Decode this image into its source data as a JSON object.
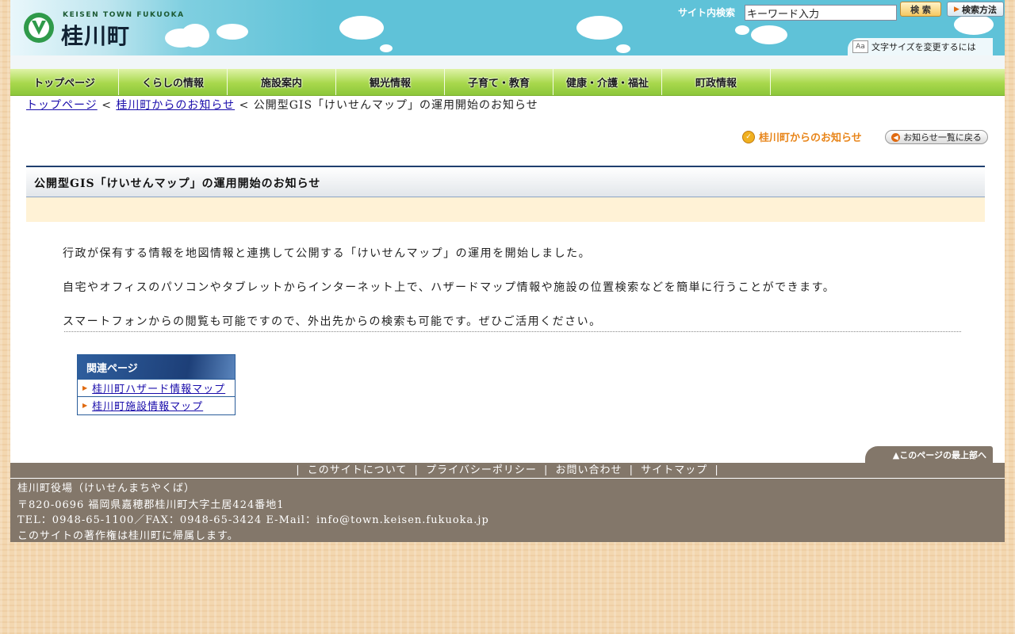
{
  "header": {
    "logo_en": "KEISEN TOWN FUKUOKA",
    "logo_jp": "桂川町",
    "search_label": "サイト内検索",
    "search_value": "キーワード入力",
    "search_button": "検 索",
    "search_method_button": "検索方法",
    "fontsize_link": "文字サイズを変更するには"
  },
  "nav": {
    "items": [
      {
        "label": "トップページ"
      },
      {
        "label": "くらしの情報"
      },
      {
        "label": "施設案内"
      },
      {
        "label": "観光情報"
      },
      {
        "label": "子育て・教育"
      },
      {
        "label": "健康・介護・福祉"
      },
      {
        "label": "町政情報"
      }
    ]
  },
  "breadcrumb": {
    "items": [
      "トップページ",
      "桂川町からのお知らせ"
    ],
    "separator": "<",
    "current": "公開型GIS「けいせんマップ」の運用開始のお知らせ"
  },
  "category": {
    "label": "桂川町からのお知らせ",
    "back_button": "お知らせ一覧に戻る"
  },
  "article": {
    "title": "公開型GIS「けいせんマップ」の運用開始のお知らせ",
    "paragraphs": [
      "行政が保有する情報を地図情報と連携して公開する「けいせんマップ」の運用を開始しました。",
      "自宅やオフィスのパソコンやタブレットからインターネット上で、ハザードマップ情報や施設の位置検索などを簡単に行うことができます。",
      "スマートフォンからの閲覧も可能ですので、外出先からの検索も可能です。ぜひご活用ください。"
    ]
  },
  "related": {
    "title": "関連ページ",
    "links": [
      "桂川町ハザード情報マップ",
      "桂川町施設情報マップ"
    ]
  },
  "page_top": "▲このページの最上部へ",
  "footer": {
    "nav": [
      "このサイトについて",
      "プライバシーポリシー",
      "お問い合わせ",
      "サイトマップ"
    ],
    "nav_separator": "|",
    "office": "桂川町役場（けいせんまちやくば）",
    "address": "〒820-0696 福岡県嘉穂郡桂川町大字土居424番地1",
    "contact": "TEL：0948-65-1100／FAX：0948-65-3424  E-Mail：info@town.keisen.fukuoka.jp",
    "copyright": "このサイトの著作権は桂川町に帰属します。"
  },
  "colors": {
    "header_sky": "#5fc2d8",
    "nav_green": "#a8d84c",
    "title_navy": "#1f3f6f",
    "meta_cream": "#fff2d6",
    "footer_brown": "#83776a",
    "category_orange": "#e8851a"
  }
}
